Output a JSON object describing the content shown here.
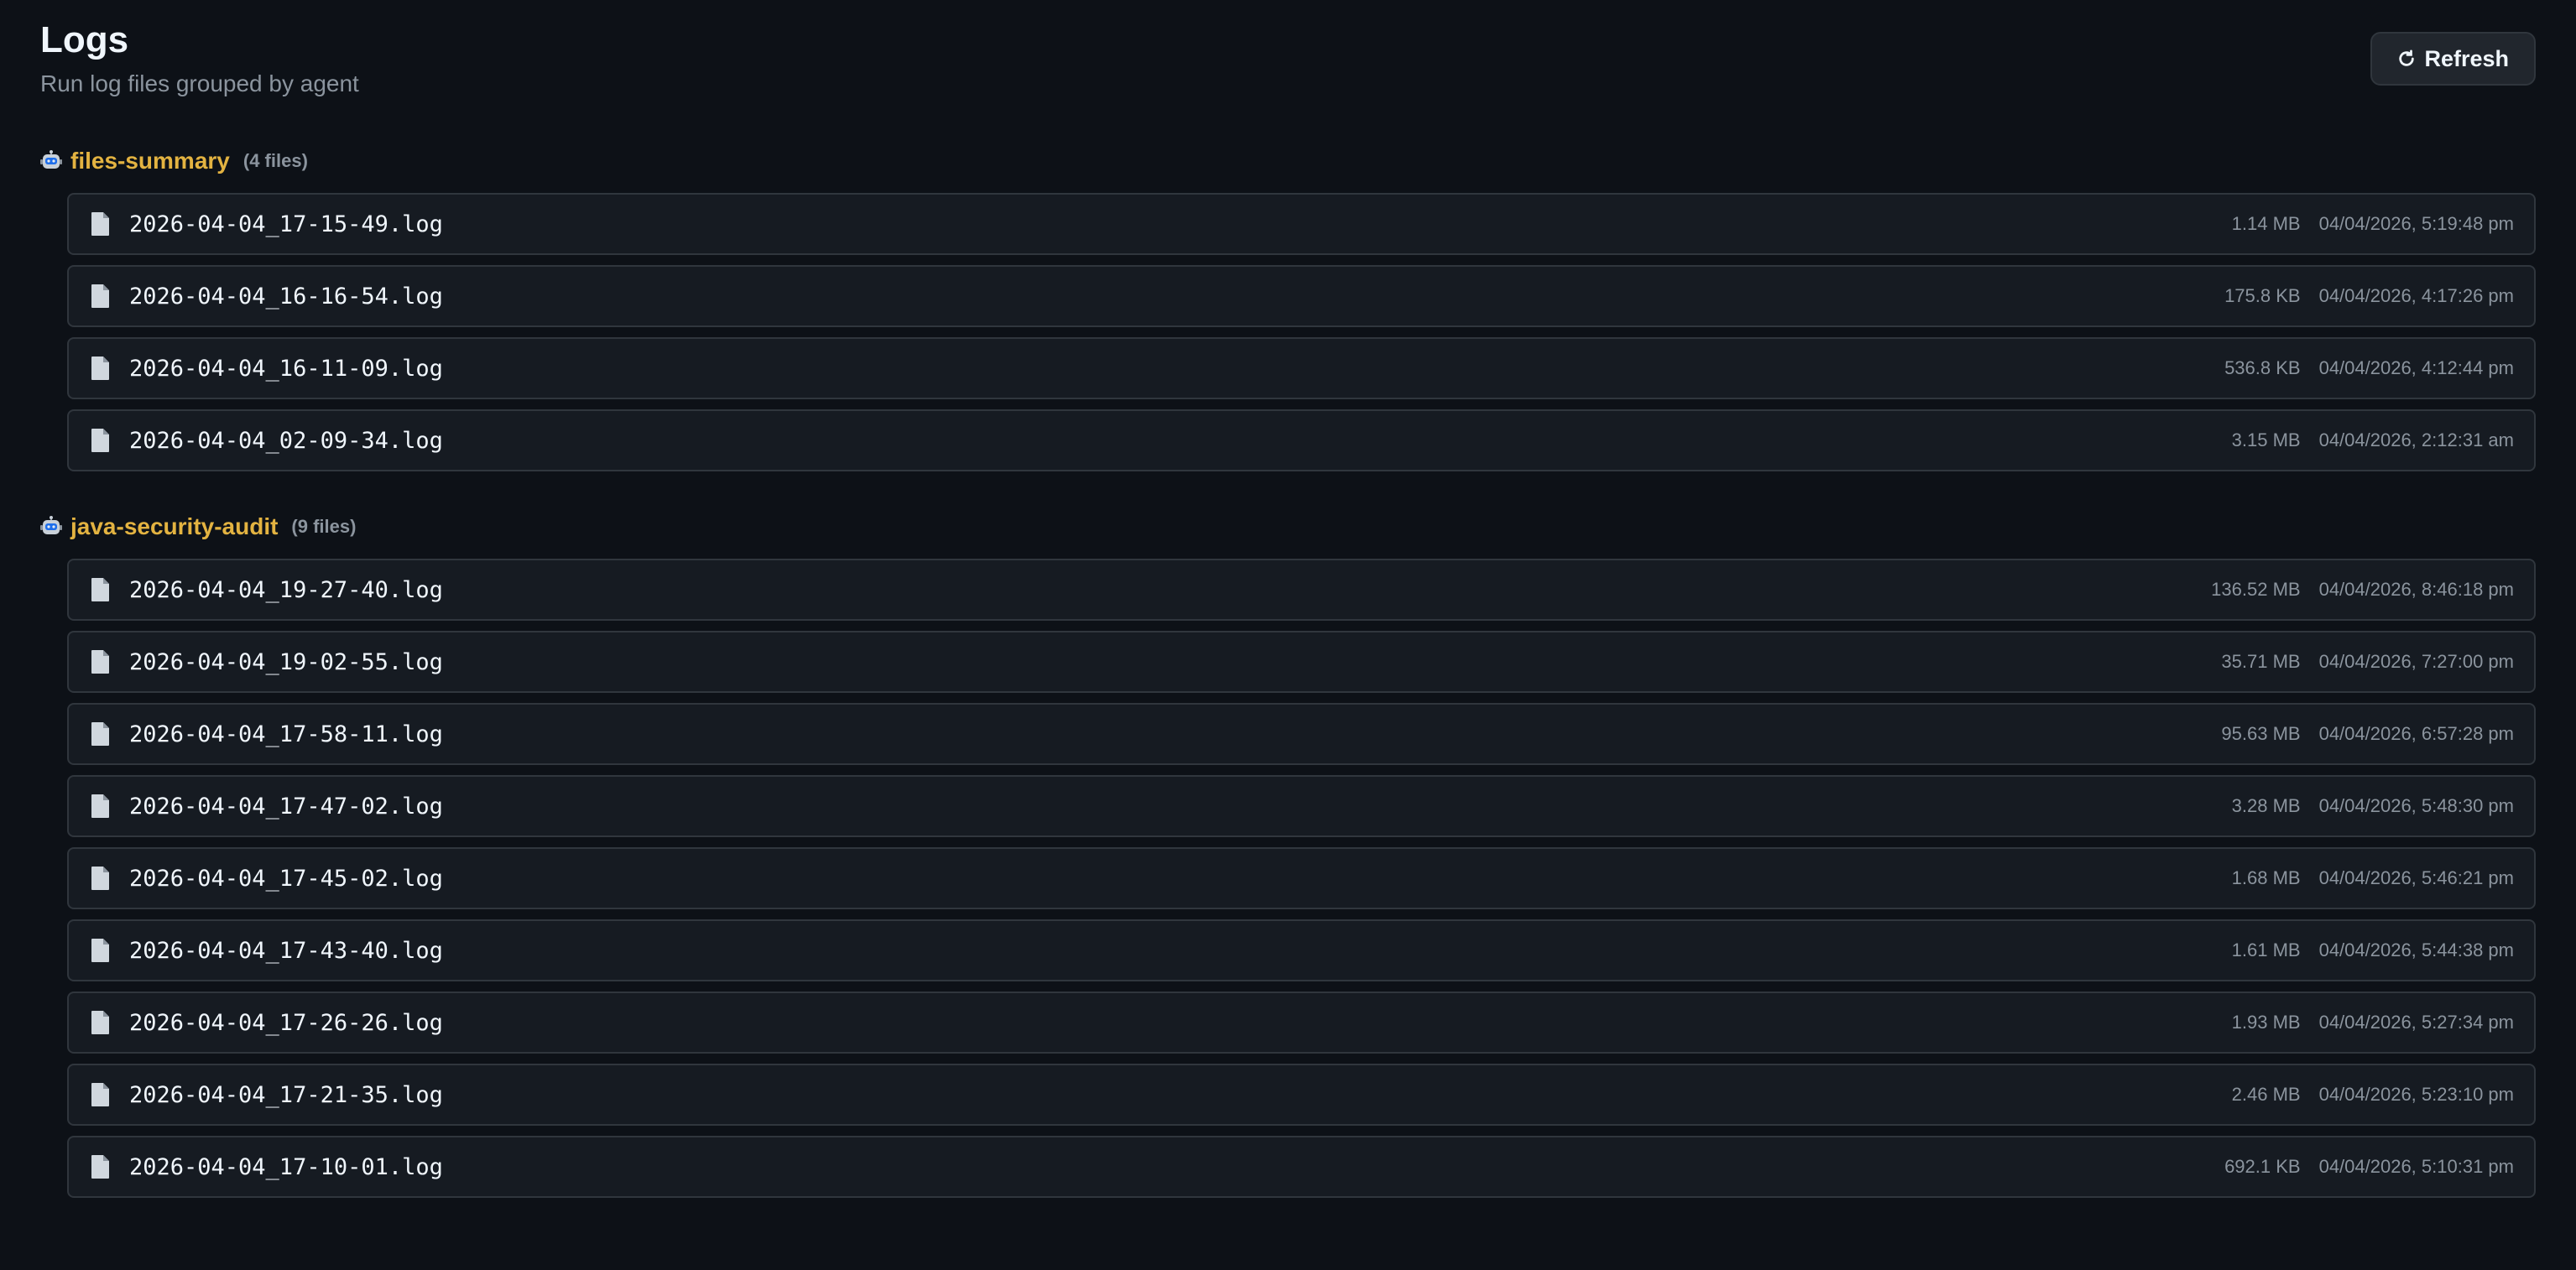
{
  "header": {
    "title": "Logs",
    "subtitle": "Run log files grouped by agent",
    "refresh_label": "Refresh"
  },
  "icons": {
    "group": "robot-icon",
    "file": "file-icon",
    "refresh": "refresh-icon"
  },
  "colors": {
    "background": "#0d1117",
    "row_background": "#161b22",
    "accent": "#e3b341",
    "muted": "#8b949e"
  },
  "groups": [
    {
      "name": "files-summary",
      "count": "(4 files)",
      "files": [
        {
          "name": "2026-04-04_17-15-49.log",
          "size": "1.14 MB",
          "date": "04/04/2026, 5:19:48 pm"
        },
        {
          "name": "2026-04-04_16-16-54.log",
          "size": "175.8 KB",
          "date": "04/04/2026, 4:17:26 pm"
        },
        {
          "name": "2026-04-04_16-11-09.log",
          "size": "536.8 KB",
          "date": "04/04/2026, 4:12:44 pm"
        },
        {
          "name": "2026-04-04_02-09-34.log",
          "size": "3.15 MB",
          "date": "04/04/2026, 2:12:31 am"
        }
      ]
    },
    {
      "name": "java-security-audit",
      "count": "(9 files)",
      "files": [
        {
          "name": "2026-04-04_19-27-40.log",
          "size": "136.52 MB",
          "date": "04/04/2026, 8:46:18 pm"
        },
        {
          "name": "2026-04-04_19-02-55.log",
          "size": "35.71 MB",
          "date": "04/04/2026, 7:27:00 pm"
        },
        {
          "name": "2026-04-04_17-58-11.log",
          "size": "95.63 MB",
          "date": "04/04/2026, 6:57:28 pm"
        },
        {
          "name": "2026-04-04_17-47-02.log",
          "size": "3.28 MB",
          "date": "04/04/2026, 5:48:30 pm"
        },
        {
          "name": "2026-04-04_17-45-02.log",
          "size": "1.68 MB",
          "date": "04/04/2026, 5:46:21 pm"
        },
        {
          "name": "2026-04-04_17-43-40.log",
          "size": "1.61 MB",
          "date": "04/04/2026, 5:44:38 pm"
        },
        {
          "name": "2026-04-04_17-26-26.log",
          "size": "1.93 MB",
          "date": "04/04/2026, 5:27:34 pm"
        },
        {
          "name": "2026-04-04_17-21-35.log",
          "size": "2.46 MB",
          "date": "04/04/2026, 5:23:10 pm"
        },
        {
          "name": "2026-04-04_17-10-01.log",
          "size": "692.1 KB",
          "date": "04/04/2026, 5:10:31 pm"
        }
      ]
    }
  ]
}
